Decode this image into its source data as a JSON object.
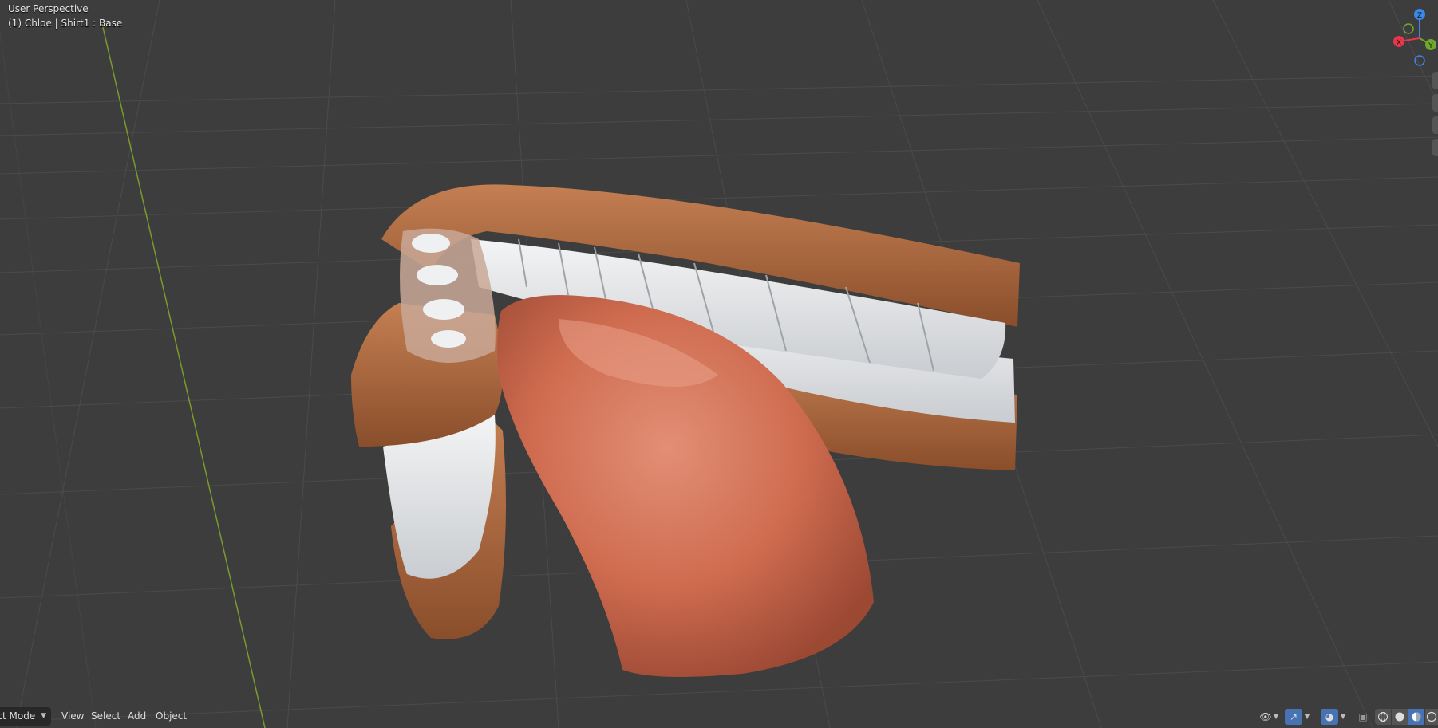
{
  "viewport": {
    "view_name": "User Perspective",
    "object_info": "(1) Chloe | Shirt1 : Base"
  },
  "gizmo": {
    "axes": [
      {
        "label": "Z",
        "color": "#3b88e8"
      },
      {
        "label": "Y",
        "color": "#6ea82c"
      },
      {
        "label": "X",
        "color": "#e8364b"
      }
    ]
  },
  "footer": {
    "mode": "ect Mode",
    "menus": [
      "View",
      "Select",
      "Add",
      "Object"
    ]
  },
  "header_icons": {
    "visibility": "eye-icon",
    "gizmo_toggle": "gizmo-icon",
    "overlay_toggle": "overlay-icon",
    "xray": "xray-icon",
    "shading_modes": [
      "wireframe",
      "solid",
      "material-preview",
      "rendered"
    ],
    "active_shading": "material-preview"
  },
  "colors": {
    "viewport_bg": "#3d3d3d",
    "grid": "#4a4a4a",
    "y_axis_line": "#7a9a2e",
    "gum": "#a8643a",
    "tongue": "#d27358",
    "teeth": "#e6e8ea",
    "accent": "#4772b3"
  }
}
